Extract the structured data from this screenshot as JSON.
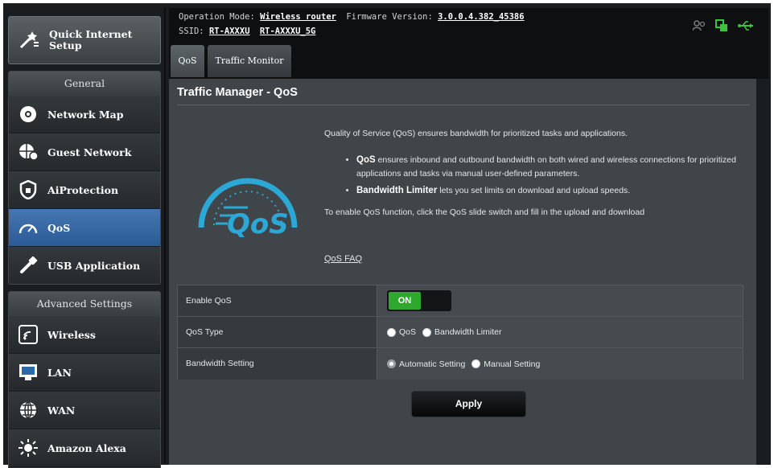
{
  "banner": {
    "operation_mode_label": "Operation Mode:",
    "operation_mode_value": "Wireless router",
    "firmware_label": "Firmware Version:",
    "firmware_value": "3.0.0.4.382_45386",
    "ssid_label": "SSID:",
    "ssid_1": "RT-AXXXU",
    "ssid_2": "RT-AXXXU_5G"
  },
  "sidebar": {
    "quick_setup": "Quick Internet\nSetup",
    "general_header": "General",
    "general_items": [
      {
        "label": "Network Map",
        "icon": "network-map-icon"
      },
      {
        "label": "Guest Network",
        "icon": "guest-network-icon"
      },
      {
        "label": "AiProtection",
        "icon": "shield-icon"
      },
      {
        "label": "QoS",
        "icon": "speedometer-icon",
        "active": true
      },
      {
        "label": "USB Application",
        "icon": "usb-icon"
      }
    ],
    "advanced_header": "Advanced Settings",
    "advanced_items": [
      {
        "label": "Wireless",
        "icon": "wireless-icon"
      },
      {
        "label": "LAN",
        "icon": "lan-icon"
      },
      {
        "label": "WAN",
        "icon": "globe-icon"
      },
      {
        "label": "Amazon Alexa",
        "icon": "alexa-icon"
      }
    ]
  },
  "tabs": [
    "QoS",
    "Traffic Monitor"
  ],
  "content": {
    "title": "Traffic Manager - QoS",
    "logo_text": "QoS",
    "intro": "Quality of Service (QoS) ensures bandwidth for prioritized tasks and applications.",
    "bullet1_bold": "QoS",
    "bullet1_text": " ensures inbound and outbound bandwidth on both wired and wireless connections for prioritized applications and tasks via manual user-defined parameters.",
    "bullet2_bold": "Bandwidth Limiter",
    "bullet2_text": " lets you set limits on download and upload speeds.",
    "enable_text": "To enable QoS function, click the QoS slide switch and fill in the upload and download",
    "faq": "QoS FAQ"
  },
  "settings": {
    "enable_label": "Enable QoS",
    "toggle_on": "ON",
    "type_label": "QoS Type",
    "type_options": [
      "QoS",
      "Bandwidth Limiter"
    ],
    "bandwidth_label": "Bandwidth Setting",
    "bandwidth_options": [
      "Automatic Setting",
      "Manual Setting"
    ]
  },
  "apply_label": "Apply"
}
